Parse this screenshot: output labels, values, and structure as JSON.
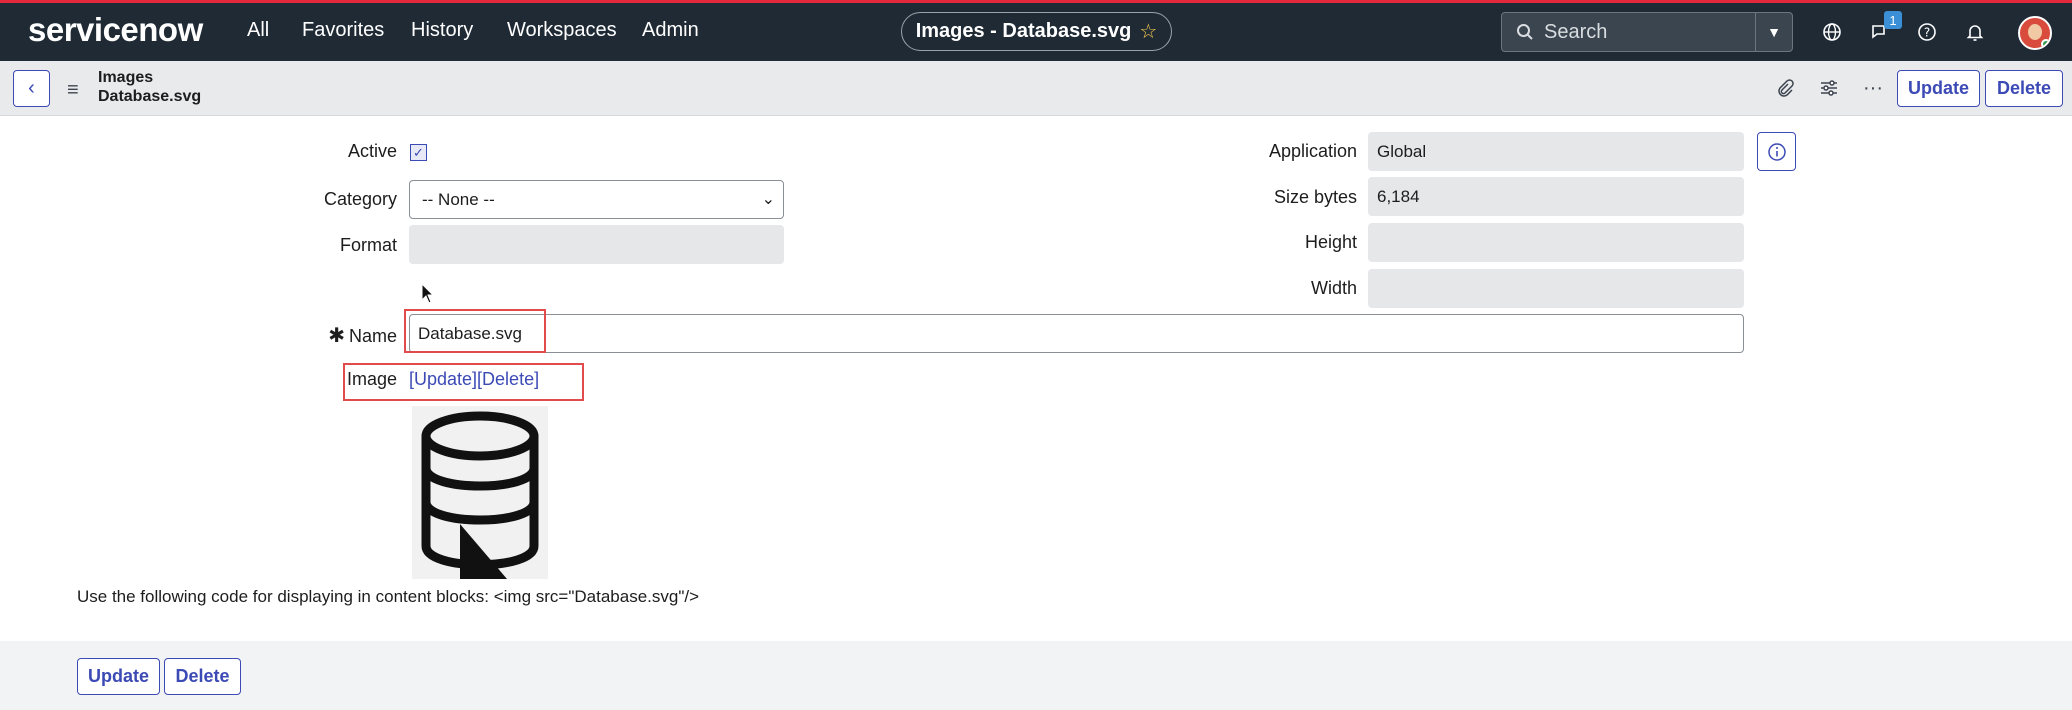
{
  "topnav": {
    "logo": "servicenow",
    "items": [
      "All",
      "Favorites",
      "History",
      "Workspaces",
      "Admin"
    ],
    "record_title": "Images - Database.svg",
    "search_placeholder": "Search",
    "chat_badge": "1"
  },
  "header": {
    "breadcrumb_table": "Images",
    "breadcrumb_record": "Database.svg",
    "update_label": "Update",
    "delete_label": "Delete"
  },
  "form": {
    "active_label": "Active",
    "active_checked": true,
    "category_label": "Category",
    "category_value": "-- None --",
    "format_label": "Format",
    "format_value": "",
    "name_label": "Name",
    "name_value": "Database.svg",
    "image_label": "Image",
    "image_update_link": "[Update]",
    "image_delete_link": "[Delete]",
    "application_label": "Application",
    "application_value": "Global",
    "size_label": "Size bytes",
    "size_value": "6,184",
    "height_label": "Height",
    "height_value": "",
    "width_label": "Width",
    "width_value": "",
    "code_hint": "Use the following code for displaying in content blocks:  <img src=\"Database.svg\"/>"
  },
  "footer": {
    "update_label": "Update",
    "delete_label": "Delete"
  },
  "colors": {
    "nav_bg": "#1f2a35",
    "accent_red": "#e5293d",
    "primary_blue": "#3c4ab5",
    "highlight_red": "#e14b4b"
  }
}
